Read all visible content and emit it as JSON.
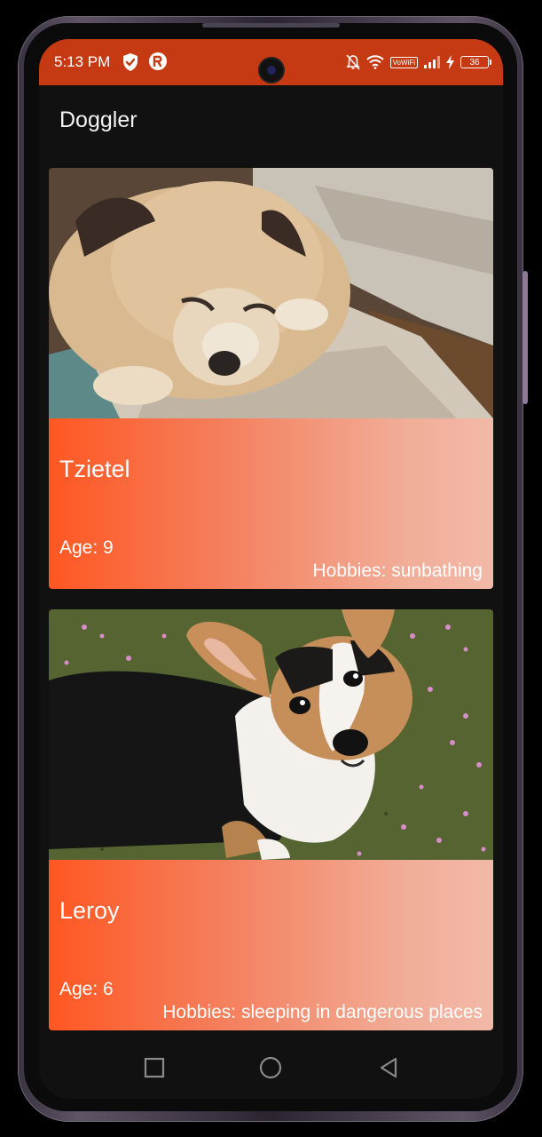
{
  "status_bar": {
    "time": "5:13 PM",
    "volte": "VoWiFi",
    "battery": "36",
    "color": "#c53a12"
  },
  "app_bar": {
    "title": "Doggler"
  },
  "dogs": [
    {
      "name": "Tzietel",
      "age_label": "Age: 9",
      "hobbies_label": "Hobbies: sunbathing",
      "image_icon": "pug-photo"
    },
    {
      "name": "Leroy",
      "age_label": "Age: 6",
      "hobbies_label": "Hobbies: sleeping in dangerous places",
      "image_icon": "corgi-photo"
    }
  ],
  "nav_bar": {
    "icons": [
      "recents-icon",
      "home-icon",
      "back-icon"
    ]
  },
  "colors": {
    "accent": "#ff5722",
    "card_gradient_end": "#f2b9a8",
    "background": "#111111"
  }
}
